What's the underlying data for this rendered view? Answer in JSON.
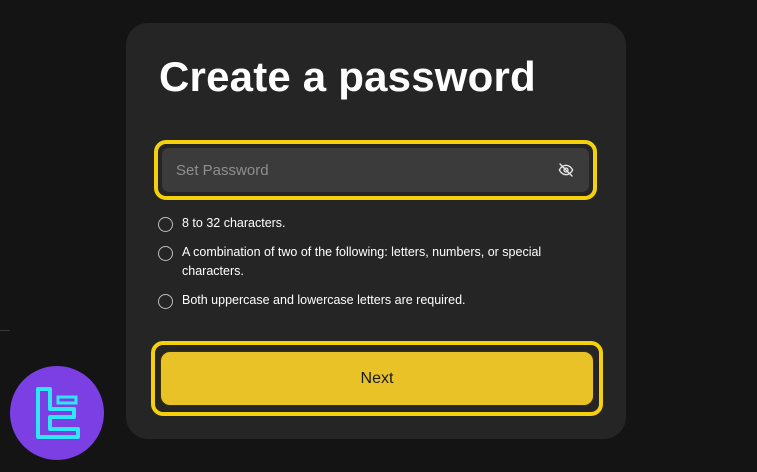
{
  "page": {
    "title": "Create a password"
  },
  "password_field": {
    "placeholder": "Set Password",
    "icon": "eye-slash-icon"
  },
  "requirements": [
    {
      "text": "8 to 32 characters."
    },
    {
      "text": "A combination of two of the following: letters, numbers, or special characters."
    },
    {
      "text": "Both uppercase and lowercase letters are required."
    }
  ],
  "next_button": {
    "label": "Next"
  },
  "colors": {
    "background": "#141414",
    "card": "#252525",
    "input": "#3b3b3b",
    "highlight": "#f5d10d",
    "button": "#e8c226",
    "logo_bg": "#7b3fe4",
    "logo_mark": "#2ee6f5"
  }
}
